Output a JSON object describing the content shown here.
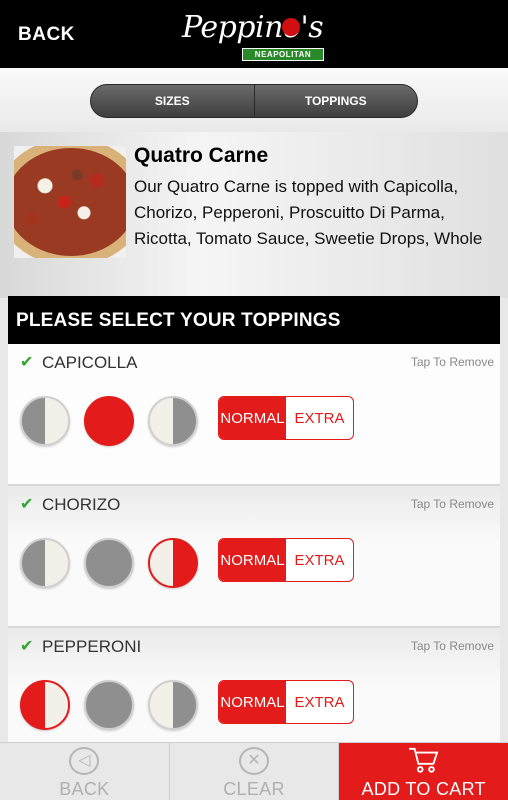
{
  "header": {
    "back_label": "BACK",
    "logo_text": "Peppino's",
    "logo_sub": "NEAPOLITAN"
  },
  "tabs": [
    {
      "label": "SIZES"
    },
    {
      "label": "TOPPINGS"
    }
  ],
  "product": {
    "title": "Quatro Carne",
    "description": "Our Quatro Carne is topped with Capicolla, Chorizo, Pepperoni, Proscuitto Di Parma, Ricotta, Tomato Sauce, Sweetie Drops, Whole"
  },
  "toppings_header": "PLEASE SELECT YOUR TOPPINGS",
  "toppings": [
    {
      "name": "CAPICOLLA",
      "remove_label": "Tap To Remove",
      "coverage": "whole",
      "amount": "NORMAL",
      "normal_label": "NORMAL",
      "extra_label": "EXTRA"
    },
    {
      "name": "CHORIZO",
      "remove_label": "Tap To Remove",
      "coverage": "right",
      "amount": "NORMAL",
      "normal_label": "NORMAL",
      "extra_label": "EXTRA"
    },
    {
      "name": "PEPPERONI",
      "remove_label": "Tap To Remove",
      "coverage": "left",
      "amount": "NORMAL",
      "normal_label": "NORMAL",
      "extra_label": "EXTRA"
    }
  ],
  "bottom_bar": {
    "back_label": "BACK",
    "clear_label": "CLEAR",
    "cart_label": "ADD TO CART"
  },
  "colors": {
    "accent": "#e31b1b",
    "check": "#2fa52f",
    "header_bg": "#000000"
  }
}
